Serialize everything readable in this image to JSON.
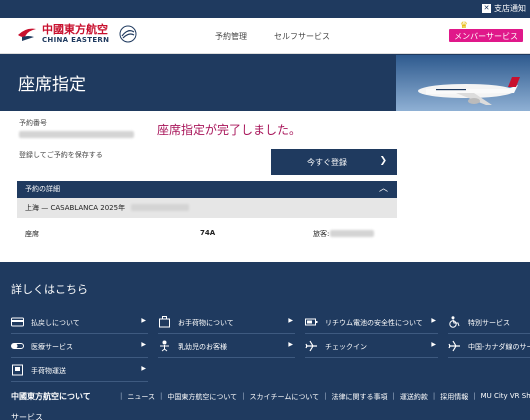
{
  "topbar": {
    "support_link": "支店通知"
  },
  "header": {
    "logo_cn": "中國東方航空",
    "logo_en": "CHINA EASTERN",
    "nav": [
      "予約管理",
      "セルフサービス"
    ],
    "member_button": "メンバーサービス"
  },
  "banner": {
    "title": "座席指定"
  },
  "content": {
    "booking_number_label": "予約番号",
    "save_prompt": "登録してご予約を保存する",
    "success_message": "座席指定が完了しました。",
    "register_button": "今すぐ登録",
    "details": {
      "header": "予約の詳細",
      "route": "上海 — CASABLANCA 2025年",
      "seat_label": "座席",
      "seat_value": "74A",
      "passenger_label": "旅客:"
    }
  },
  "more_info": {
    "title": "詳しくはこちら",
    "items": [
      {
        "label": "払戻しについて",
        "icon": "card-icon"
      },
      {
        "label": "お手荷物について",
        "icon": "luggage-icon"
      },
      {
        "label": "リチウム電池の安全性について",
        "icon": "battery-icon"
      },
      {
        "label": "特別サービス",
        "icon": "wheelchair-icon"
      },
      {
        "label": "医療サービス",
        "icon": "medical-icon"
      },
      {
        "label": "乳幼児のお客様",
        "icon": "infant-icon"
      },
      {
        "label": "チェックイン",
        "icon": "plane-icon"
      },
      {
        "label": "中国-カナダ線のサー",
        "icon": "plane-icon"
      },
      {
        "label": "手荷物運送",
        "icon": "bag-icon"
      }
    ]
  },
  "footer": {
    "heading": "中國東方航空について",
    "links": [
      "ニュース",
      "中国東方航空について",
      "スカイチームについて",
      "法律に関する事項",
      "運送約款",
      "採用情報",
      "MU City VR Show"
    ],
    "bottom_heading": "サービス"
  },
  "colors": {
    "navy": "#1f3a5f",
    "success": "#a8155a",
    "member": "#e0188a",
    "brand_red": "#c8102e"
  }
}
